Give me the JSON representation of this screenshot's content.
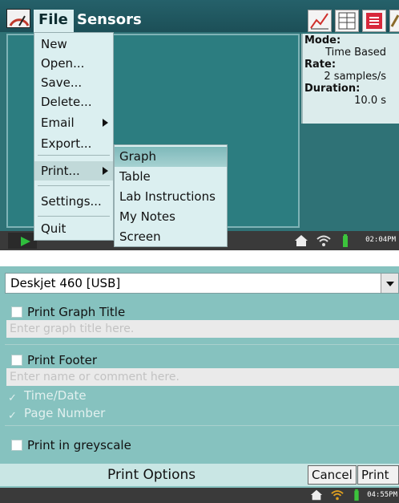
{
  "screen1": {
    "menubar": {
      "file": "File",
      "sensors": "Sensors"
    },
    "info": {
      "mode_label": "Mode:",
      "mode_value": "Time Based",
      "rate_label": "Rate:",
      "rate_value": "2 samples/s",
      "duration_label": "Duration:",
      "duration_value": "10.0 s"
    },
    "file_menu": {
      "new": "New",
      "open": "Open...",
      "save": "Save...",
      "delete": "Delete...",
      "email": "Email",
      "export": "Export...",
      "print": "Print...",
      "settings": "Settings...",
      "quit": "Quit"
    },
    "print_submenu": {
      "graph": "Graph",
      "table": "Table",
      "lab_instructions": "Lab Instructions",
      "my_notes": "My Notes",
      "screen": "Screen"
    },
    "status_time": "02:04PM"
  },
  "screen2": {
    "printer": "Deskjet 460 [USB]",
    "print_graph_title": "Print Graph Title",
    "graph_title_placeholder": "Enter graph title here.",
    "print_footer": "Print Footer",
    "footer_placeholder": "Enter name or comment here.",
    "time_date": "Time/Date",
    "page_number": "Page Number",
    "greyscale": "Print in greyscale",
    "footer_title": "Print Options",
    "cancel": "Cancel",
    "print": "Print",
    "status_time": "04:55PM"
  },
  "icons": {
    "check": "✓",
    "home": "⌂",
    "wifi": "wifi-icon",
    "battery": "battery-icon"
  },
  "colors": {
    "teal_bg": "#2f7276",
    "dialog_bg": "#86c2bf",
    "menu_bg": "#dbeff0"
  }
}
